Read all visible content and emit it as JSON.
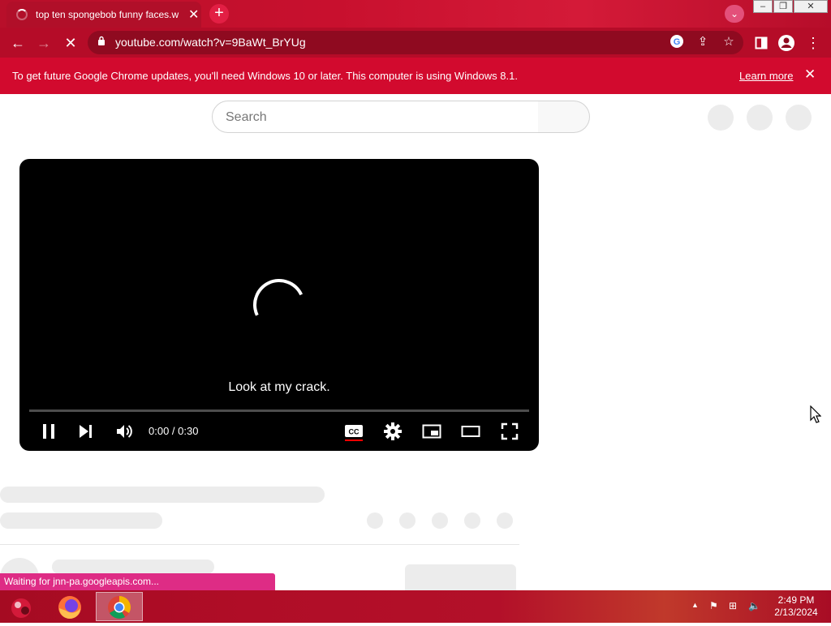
{
  "browser": {
    "tab_title": "top ten spongebob funny faces.w",
    "tab_close": "✕",
    "new_tab": "+",
    "url": "youtube.com/watch?v=9BaWt_BrYUg"
  },
  "infobar": {
    "message": "To get future Google Chrome updates, you'll need Windows 10 or later. This computer is using Windows 8.1.",
    "link": "Learn more",
    "close": "✕"
  },
  "youtube": {
    "search_placeholder": "Search"
  },
  "player": {
    "caption": "Look at my crack.",
    "time": "0:00 / 0:30",
    "progress": 0
  },
  "statusbar": {
    "text": "Waiting for jnn-pa.googleapis.com..."
  },
  "taskbar": {
    "time": "2:49 PM",
    "date": "2/13/2024"
  },
  "colors": {
    "theme_red": "#c8102e",
    "infobar_red": "#d20a2e",
    "status_pink": "#de2c85",
    "cc_underline": "#ff0000"
  }
}
